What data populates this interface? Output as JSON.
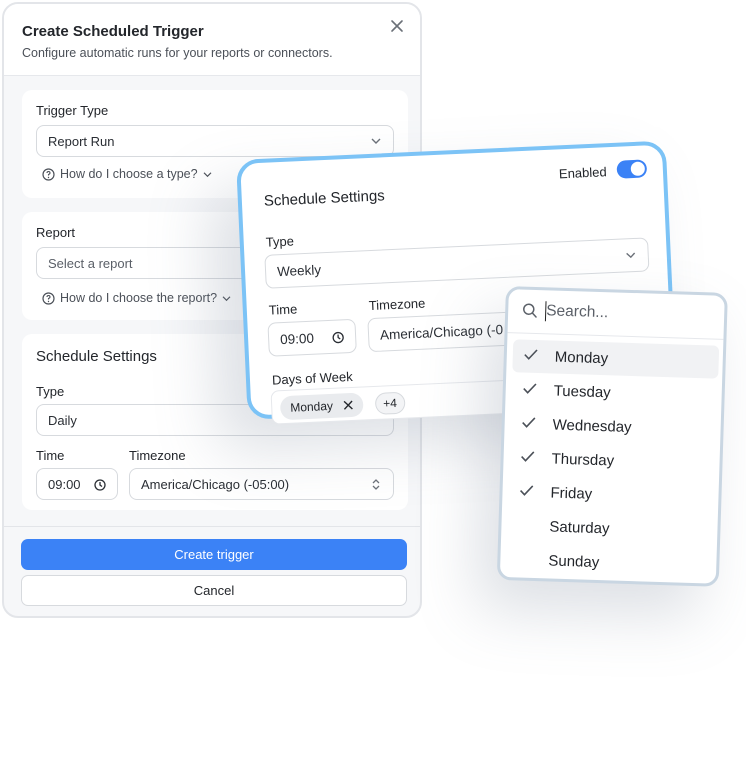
{
  "panel": {
    "title": "Create Scheduled Trigger",
    "subtitle": "Configure automatic runs for your reports or connectors.",
    "close_icon": "close-icon",
    "trigger_type": {
      "label": "Trigger Type",
      "value": "Report Run",
      "help": "How do I choose a type?"
    },
    "report": {
      "label": "Report",
      "placeholder": "Select a report",
      "help": "How do I choose the report?"
    },
    "schedule": {
      "title": "Schedule Settings",
      "type_label": "Type",
      "type_value": "Daily",
      "time_label": "Time",
      "time_value": "09:00",
      "timezone_label": "Timezone",
      "timezone_value": "America/Chicago (-05:00)"
    },
    "create_button": "Create trigger",
    "cancel_button": "Cancel",
    "colors": {
      "primary": "#3b82f6",
      "panel_bg": "#f6f7f9"
    }
  },
  "schedule_card": {
    "title": "Schedule Settings",
    "enabled_label": "Enabled",
    "enabled": true,
    "type_label": "Type",
    "type_value": "Weekly",
    "time_label": "Time",
    "time_value": "09:00",
    "timezone_label": "Timezone",
    "timezone_value": "America/Chicago (-0",
    "days_label": "Days of Week",
    "chip_monday": "Monday",
    "chip_more": "+4",
    "border_color": "#7cc3f6"
  },
  "dropdown": {
    "search_placeholder": "Search...",
    "options": [
      {
        "label": "Monday",
        "checked": true
      },
      {
        "label": "Tuesday",
        "checked": true
      },
      {
        "label": "Wednesday",
        "checked": true
      },
      {
        "label": "Thursday",
        "checked": true
      },
      {
        "label": "Friday",
        "checked": true
      },
      {
        "label": "Saturday",
        "checked": false
      },
      {
        "label": "Sunday",
        "checked": false
      }
    ]
  }
}
